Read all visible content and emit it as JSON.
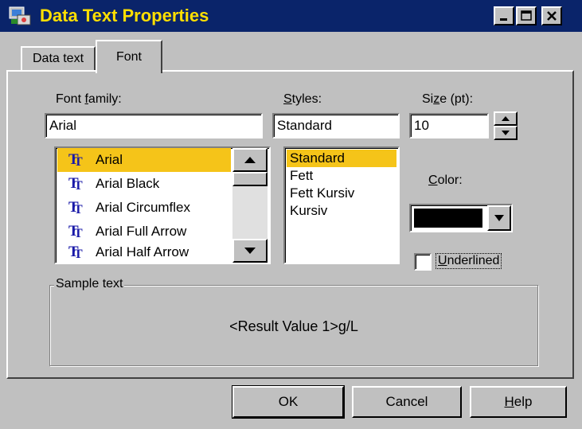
{
  "window": {
    "title": "Data Text Properties",
    "controls": [
      "minimize",
      "maximize",
      "close"
    ]
  },
  "tabs": [
    {
      "label": "Data text",
      "active": false
    },
    {
      "label": "Font",
      "active": true
    }
  ],
  "font_family": {
    "label_pre": "Font ",
    "label_accel": "f",
    "label_post": "amily:",
    "value": "Arial",
    "items": [
      "Arial",
      "Arial Black",
      "Arial Circumflex",
      "Arial Full Arrow",
      "Arial Half Arrow"
    ],
    "selected_index": 0
  },
  "styles": {
    "label_accel": "S",
    "label_post": "tyles:",
    "value": "Standard",
    "items": [
      "Standard",
      "Fett",
      "Fett Kursiv",
      "Kursiv"
    ],
    "selected_index": 0
  },
  "size": {
    "label_pre": "Si",
    "label_accel": "z",
    "label_post": "e (pt):",
    "value": "10"
  },
  "color": {
    "label_accel": "C",
    "label_post": "olor:",
    "value_hex": "#000000"
  },
  "underlined": {
    "label_accel": "U",
    "label_post": "nderlined",
    "checked": false
  },
  "sample": {
    "group_label": "Sample text",
    "text": "<Result Value 1>g/L"
  },
  "buttons": {
    "ok": "OK",
    "cancel": "Cancel",
    "help_accel": "H",
    "help_post": "elp"
  },
  "colors": {
    "titlebar": "#0a246a",
    "title_text": "#ffdf00",
    "selection": "#f5c419",
    "face": "#c0c0c0"
  }
}
